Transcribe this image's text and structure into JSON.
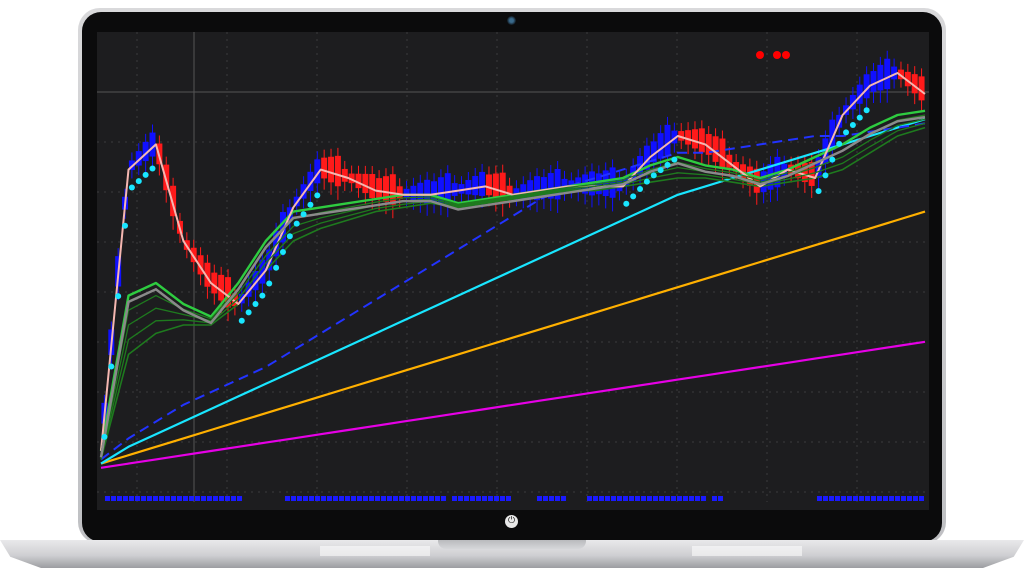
{
  "device": {
    "name": "laptop-mockup"
  },
  "icons": {
    "power": "power-icon",
    "camera": "camera-icon"
  },
  "power_glyph": "⏻",
  "colors": {
    "background": "#1d1d1f",
    "grid": "#3c3c3e",
    "candle_up": "#1010ff",
    "candle_down": "#ff1a1a",
    "fast_line": "#f5b7b1",
    "dots": "#19e6ff",
    "green": "#2ecc40",
    "gray": "#8a8a8a",
    "dark_green": "#1e7a1e",
    "dashed_blue": "#2233ff",
    "cyan": "#19e6ff",
    "orange": "#ffb000",
    "magenta": "#e600e6",
    "signal_dots": "#ff0000",
    "bottom_bar": "#1a1aff"
  },
  "chart_data": {
    "type": "line",
    "grid": true,
    "series": [
      {
        "values": [
          5,
          72,
          78,
          55,
          45,
          40,
          48,
          63,
          72,
          70,
          67,
          66,
          66,
          67,
          68,
          66,
          67,
          68,
          68,
          68,
          75,
          80,
          78,
          73,
          68,
          72,
          70,
          85,
          92,
          95,
          90
        ]
      },
      {
        "values": [
          5,
          42,
          45,
          40,
          37,
          45,
          55,
          62,
          63,
          64,
          65,
          66,
          66,
          64,
          65,
          66,
          67,
          68,
          69,
          70,
          73,
          75,
          73,
          72,
          70,
          72,
          75,
          78,
          82,
          85,
          86
        ]
      },
      {
        "values": [
          3,
          28,
          33,
          35,
          35,
          40,
          48,
          55,
          58,
          60,
          62,
          63,
          64,
          63,
          64,
          65,
          66,
          67,
          67,
          68,
          69,
          70,
          70,
          69,
          68,
          69,
          70,
          72,
          76,
          80,
          82
        ]
      },
      {
        "values": [
          3,
          8,
          12,
          16,
          19,
          22,
          25,
          29,
          33,
          37,
          41,
          45,
          49,
          53,
          57,
          61,
          65,
          68,
          70,
          72,
          74,
          76,
          76,
          77,
          78,
          79,
          80,
          80,
          81,
          82,
          83
        ]
      },
      {
        "values": [
          2,
          6,
          9,
          12,
          15,
          18,
          21,
          24,
          27,
          30,
          33,
          36,
          39,
          42,
          45,
          48,
          51,
          54,
          57,
          60,
          63,
          66,
          68,
          70,
          72,
          74,
          76,
          78,
          80,
          82,
          84
        ]
      },
      {
        "values": [
          2,
          4,
          6,
          8,
          10,
          12,
          14,
          16,
          18,
          20,
          22,
          24,
          26,
          28,
          30,
          32,
          34,
          36,
          38,
          40,
          42,
          44,
          46,
          48,
          50,
          52,
          54,
          56,
          58,
          60,
          62
        ]
      },
      {
        "values": [
          1,
          2,
          3,
          4,
          5,
          6,
          7,
          8,
          9,
          10,
          11,
          12,
          13,
          14,
          15,
          16,
          17,
          18,
          19,
          20,
          21,
          22,
          23,
          24,
          25,
          26,
          27,
          28,
          29,
          30,
          31
        ]
      }
    ]
  }
}
